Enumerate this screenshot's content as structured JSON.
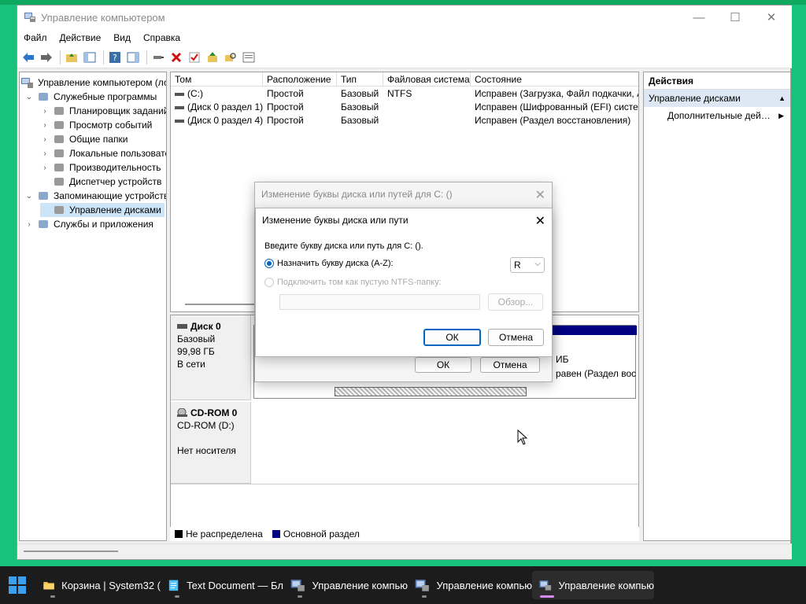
{
  "window": {
    "title": "Управление компьютером"
  },
  "menu": [
    "Файл",
    "Действие",
    "Вид",
    "Справка"
  ],
  "tree": {
    "root": "Управление компьютером (локальным)",
    "items": [
      {
        "label": "Служебные программы",
        "indent": 1,
        "exp": "v"
      },
      {
        "label": "Планировщик заданий",
        "indent": 2,
        "exp": ">"
      },
      {
        "label": "Просмотр событий",
        "indent": 2,
        "exp": ">"
      },
      {
        "label": "Общие папки",
        "indent": 2,
        "exp": ">"
      },
      {
        "label": "Локальные пользователи и группы",
        "indent": 2,
        "exp": ">"
      },
      {
        "label": "Производительность",
        "indent": 2,
        "exp": ">"
      },
      {
        "label": "Диспетчер устройств",
        "indent": 2,
        "exp": ""
      },
      {
        "label": "Запоминающие устройства",
        "indent": 1,
        "exp": "v"
      },
      {
        "label": "Управление дисками",
        "indent": 2,
        "exp": "",
        "selected": true
      },
      {
        "label": "Службы и приложения",
        "indent": 1,
        "exp": ">"
      }
    ]
  },
  "volumes": {
    "columns": [
      "Том",
      "Расположение",
      "Тип",
      "Файловая система",
      "Состояние"
    ],
    "rows": [
      {
        "vol": "(C:)",
        "layout": "Простой",
        "type": "Базовый",
        "fs": "NTFS",
        "status": "Исправен (Загрузка, Файл подкачки, А"
      },
      {
        "vol": "(Диск 0 раздел 1)",
        "layout": "Простой",
        "type": "Базовый",
        "fs": "",
        "status": "Исправен (Шифрованный (EFI) систем"
      },
      {
        "vol": "(Диск 0 раздел 4)",
        "layout": "Простой",
        "type": "Базовый",
        "fs": "",
        "status": "Исправен (Раздел восстановления)"
      }
    ]
  },
  "disks": [
    {
      "name": "Диск 0",
      "type": "Базовый",
      "size": "99,98 ГБ",
      "state": "В сети"
    },
    {
      "name": "CD-ROM 0",
      "type": "CD-ROM (D:)",
      "size": "",
      "state": "Нет носителя"
    }
  ],
  "partition_text": {
    "a": "ИБ",
    "b": "равен (Раздел вос"
  },
  "legend": [
    {
      "label": "Не распределена",
      "color": "#000000"
    },
    {
      "label": "Основной раздел",
      "color": "#000080"
    }
  ],
  "actions": {
    "header": "Действия",
    "section": "Управление дисками",
    "item": "Дополнительные действия"
  },
  "dialog_back": {
    "title": "Изменение буквы диска или путей для C: ()",
    "ok": "ОК",
    "cancel": "Отмена"
  },
  "dialog": {
    "title": "Изменение буквы диска или пути",
    "prompt": "Введите букву диска или путь для C: ().",
    "radio1": "Назначить букву диска (A-Z):",
    "radio2": "Подключить том как пустую NTFS-папку:",
    "letter": "R",
    "browse": "Обзор...",
    "ok": "ОК",
    "cancel": "Отмена"
  },
  "taskbar": [
    {
      "label": "Корзина | System32 (",
      "icon": "folder-icon"
    },
    {
      "label": "Text Document — Бл",
      "icon": "notepad-icon"
    },
    {
      "label": "Управление компью",
      "icon": "computer-management-icon"
    },
    {
      "label": "Управление компью",
      "icon": "computer-management-icon"
    },
    {
      "label": "Управление компью",
      "icon": "computer-management-icon"
    }
  ],
  "colors": {
    "accent": "#0067c0",
    "desktop": "#19c27a"
  }
}
